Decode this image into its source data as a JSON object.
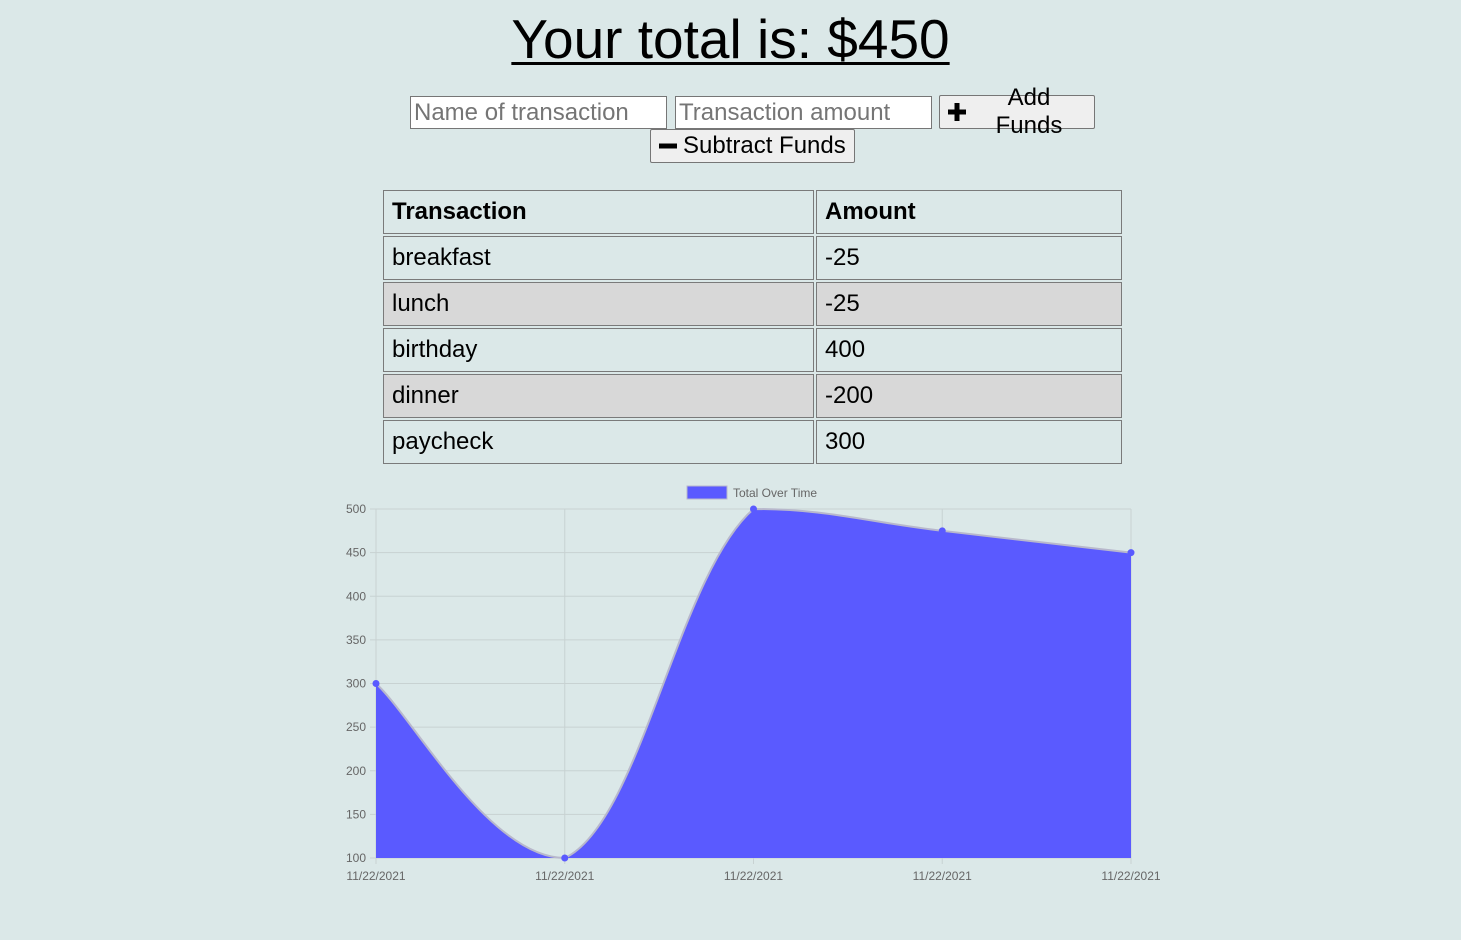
{
  "header": {
    "total_label": "Your total is: $450"
  },
  "form": {
    "name_placeholder": "Name of transaction",
    "amount_placeholder": "Transaction amount",
    "add_label": "Add Funds",
    "subtract_label": "Subtract Funds"
  },
  "table": {
    "headers": [
      "Transaction",
      "Amount"
    ],
    "rows": [
      {
        "name": "breakfast",
        "amount": "-25"
      },
      {
        "name": "lunch",
        "amount": "-25"
      },
      {
        "name": "birthday",
        "amount": "400"
      },
      {
        "name": "dinner",
        "amount": "-200"
      },
      {
        "name": "paycheck",
        "amount": "300"
      }
    ]
  },
  "colors": {
    "background": "#dbe8e8",
    "series_fill": "#5a5aff",
    "series_line": "#b8b8cc",
    "grid": "#c8d2d2",
    "row_alt": "#d8d8d8"
  },
  "chart_data": {
    "type": "area",
    "x": [
      "11/22/2021",
      "11/22/2021",
      "11/22/2021",
      "11/22/2021",
      "11/22/2021"
    ],
    "series": [
      {
        "name": "Total Over Time",
        "values": [
          300,
          100,
          500,
          475,
          450
        ]
      }
    ],
    "ylim": [
      100,
      500
    ],
    "yticks": [
      100,
      150,
      200,
      250,
      300,
      350,
      400,
      450,
      500
    ],
    "grid": true,
    "legend": "top-center",
    "title": "",
    "xlabel": "",
    "ylabel": ""
  }
}
